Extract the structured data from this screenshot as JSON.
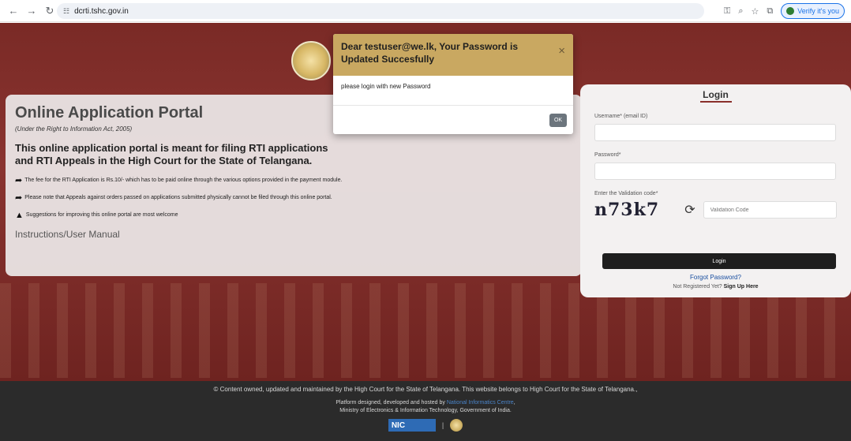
{
  "browser": {
    "url": "dcrti.tshc.gov.in",
    "verify_label": "Verify it's you"
  },
  "info": {
    "title": "Online Application Portal",
    "subtitle": "(Under the Right to Information Act, 2005)",
    "lead": "This online application portal is meant for filing RTI applications and RTI Appeals in the High Court for the State of Telangana.",
    "bullets": [
      "The fee for the RTI Application is Rs.10/- which has to be paid online through the various options provided in the payment module.",
      "Please note that Appeals against orders passed on applications submitted physically cannot be filed through this online portal.",
      "Suggestions for improving this online portal are most welcome"
    ],
    "manual_link": "Instructions/User Manual"
  },
  "login": {
    "title": "Login",
    "username_label": "Username* (email ID)",
    "password_label": "Password*",
    "validation_label": "Enter the Validation code*",
    "captcha": "n73k7",
    "captcha_placeholder": "Validation Code",
    "login_button": "Login",
    "forgot": "Forgot Password?",
    "not_registered": "Not Registered Yet? ",
    "sign_up": "Sign Up Here"
  },
  "modal": {
    "title": "Dear testuser@we.lk, Your Password is Updated Succesfully",
    "close": "×",
    "body": "please login with new Password",
    "ok": "OK"
  },
  "footer": {
    "line1": "© Content owned, updated and maintained by the High Court for the State of Telangana. This website belongs to High Court for the State of Telangana.,",
    "line2_prefix": "Platform designed, developed and hosted by ",
    "line2_link": "National Informatics Centre",
    "line2_suffix": ",",
    "line3": "Ministry of Electronics & Information Technology, Government of India.",
    "nic_logo": "NIC",
    "separator": "|"
  }
}
